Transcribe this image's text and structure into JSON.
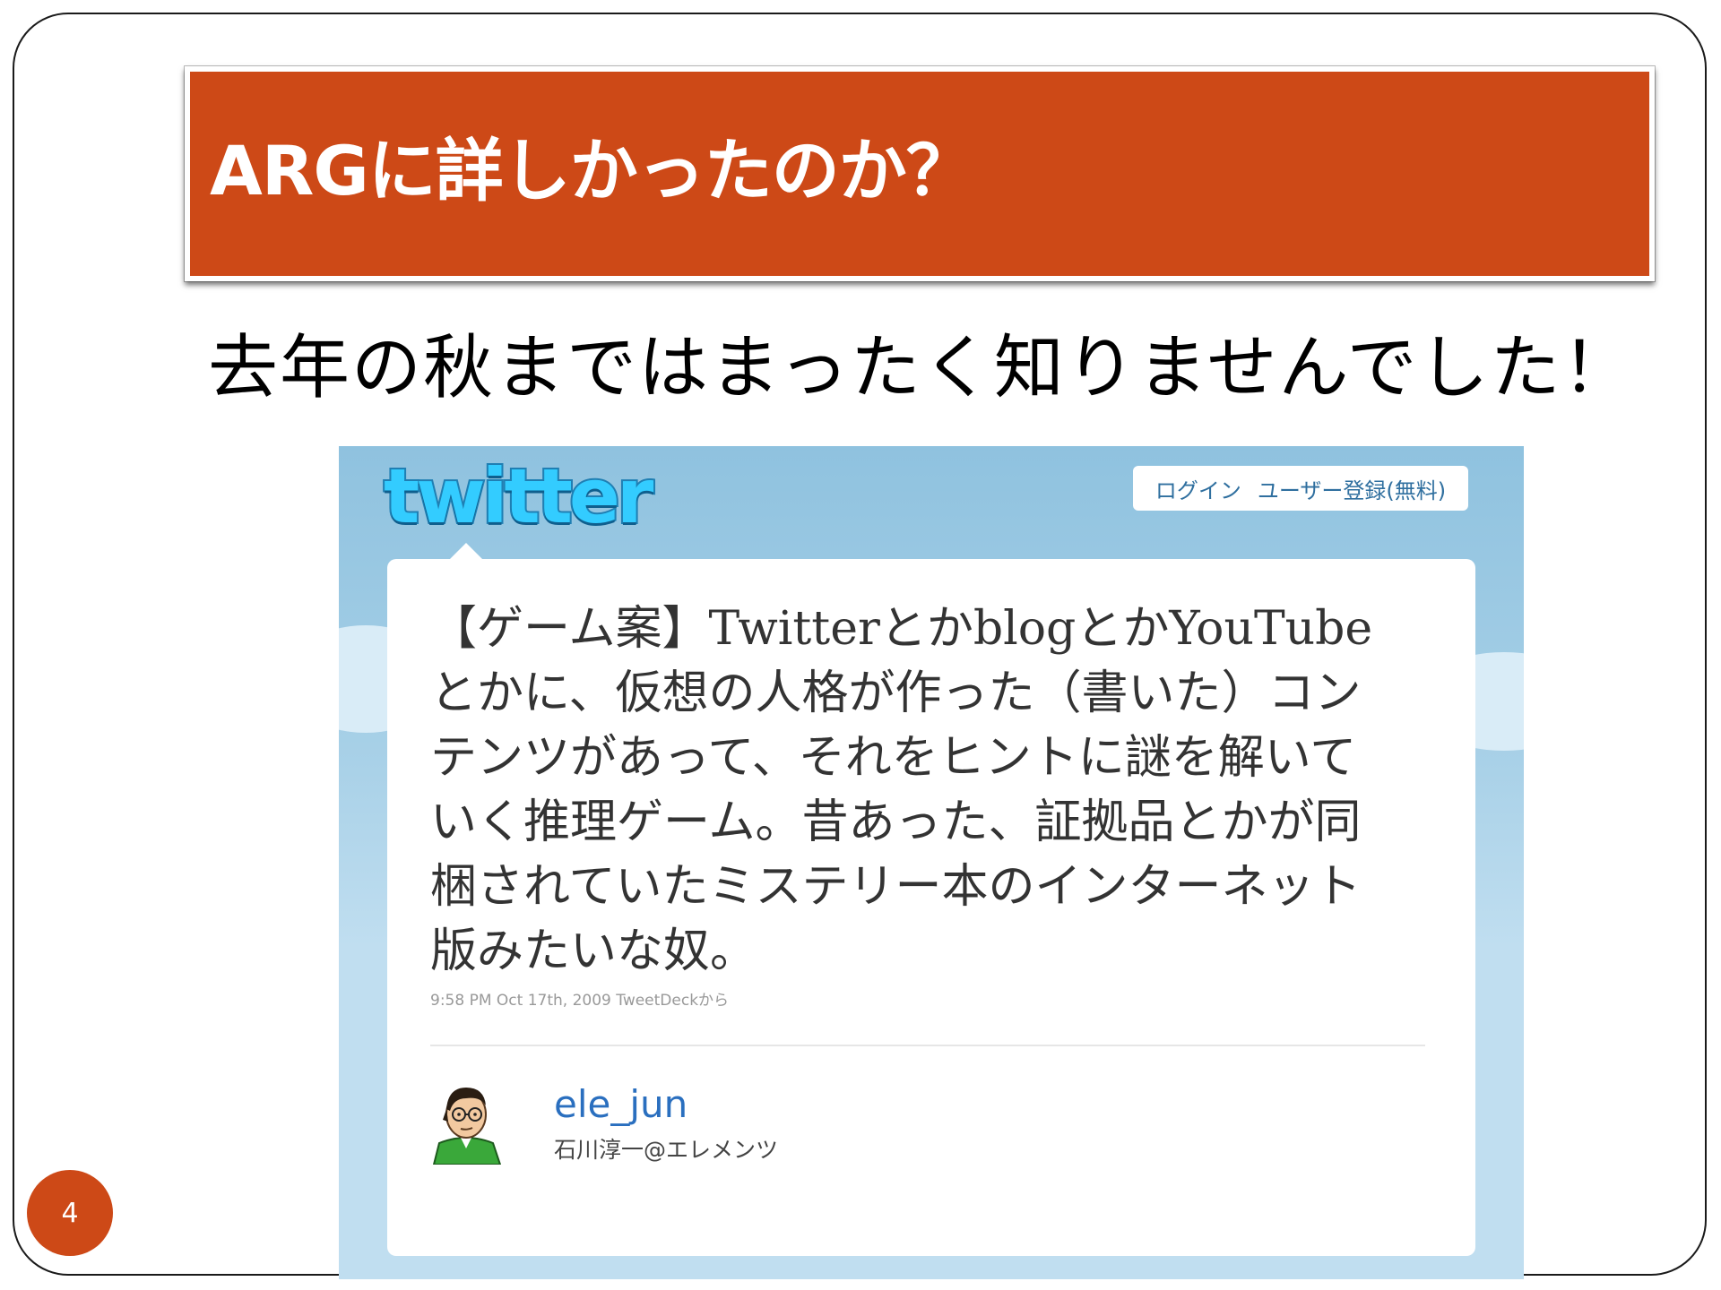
{
  "slide": {
    "title": "ARGに詳しかったのか？",
    "subtitle": "去年の秋まではまったく知りませんでした！",
    "page_number": "4"
  },
  "twitter": {
    "logo_text": "twitter",
    "login_label": "ログイン",
    "signup_label": "ユーザー登録(無料)",
    "tweet_text": "【ゲーム案】TwitterとかblogとかYouTubeとかに、仮想の人格が作った（書いた）コンテンツがあって、それをヒントに謎を解いていく推理ゲーム。昔あった、証拠品とかが同梱されていたミステリー本のインターネット版みたいな奴。",
    "tweet_meta": "9:58 PM Oct 17th, 2009 TweetDeckから",
    "user_handle": "ele_jun",
    "user_name": "石川淳一@エレメンツ"
  },
  "colors": {
    "accent": "#cd4917",
    "twitter_sky": "#c0def0",
    "twitter_link": "#2a6fbf"
  }
}
